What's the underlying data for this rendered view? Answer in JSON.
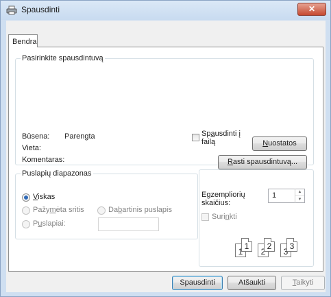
{
  "window": {
    "title": "Spausdinti",
    "close_glyph": "✕"
  },
  "tab": {
    "label": "Bendra"
  },
  "printer_group": {
    "legend": "Pasirinkite spausdintuvą",
    "status_label": "Būsena:",
    "status_value": "Parengta",
    "location_label": "Vieta:",
    "comment_label": "Komentaras:",
    "print_to_file_pre": "Sp",
    "print_to_file_mn": "a",
    "print_to_file_mid": "usdinti į",
    "print_to_file_line2": "failą",
    "preferences_mn": "N",
    "preferences_rest": "uostatos",
    "find_printer_mn": "R",
    "find_printer_rest": "asti spausdintuvą..."
  },
  "range_group": {
    "legend": "Puslapių diapazonas",
    "all_mn": "V",
    "all_rest": "iskas",
    "selection_pre": "Pažy",
    "selection_mn": "m",
    "selection_rest": "ėta sritis",
    "current_pre": "Da",
    "current_mn": "b",
    "current_rest": "artinis puslapis",
    "pages_pre": "P",
    "pages_mn": "u",
    "pages_rest": "slapiai:",
    "pages_value": ""
  },
  "copies": {
    "label_pre": "E",
    "label_mn": "g",
    "label_rest": "zempliorių",
    "label_line2": "skaičius:",
    "value": "1",
    "collate_pre": "Suri",
    "collate_mn": "n",
    "collate_rest": "kti",
    "collate_icon_pages": [
      "1",
      "1",
      "2",
      "2",
      "3",
      "3"
    ]
  },
  "footer": {
    "print_label": "Spausdinti",
    "cancel_label": "Atšaukti",
    "apply_mn": "T",
    "apply_rest": "aikyti"
  }
}
